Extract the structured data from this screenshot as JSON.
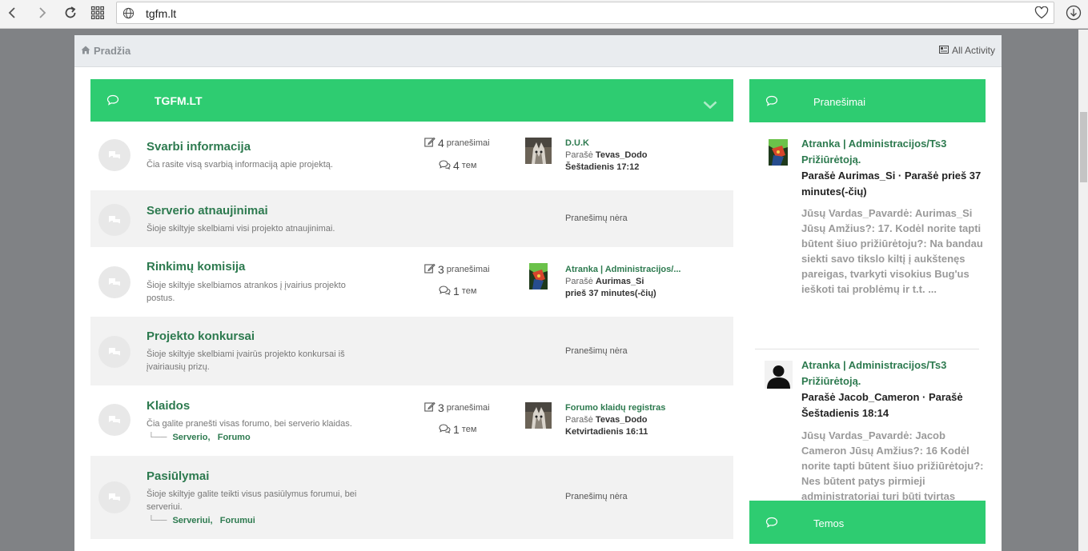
{
  "browser": {
    "url": "tgfm.lt"
  },
  "breadcrumb": {
    "home": "Pradžia",
    "all_activity": "All Activity"
  },
  "forum": {
    "title": "TGFM.LT",
    "categories": [
      {
        "name": "Svarbi informacija",
        "desc": "Čia rasite visą svarbią informaciją apie projektą.",
        "posts_count": "4",
        "posts_label": "pranešimai",
        "topics_count": "4",
        "topics_label": "тем",
        "last_title": "D.U.K",
        "last_by_prefix": "Parašė",
        "last_by": "Tevas_Dodo",
        "last_when": "Šeštadienis 17:12"
      },
      {
        "name": "Serverio atnaujinimai",
        "desc": "Šioje skiltyje skelbiami visi projekto atnaujinimai.",
        "no_posts": "Pranešimų nėra"
      },
      {
        "name": "Rinkimų komisija",
        "desc": "Šioje skiltyje skelbiamos atrankos į įvairius projekto postus.",
        "posts_count": "3",
        "posts_label": "pranešimai",
        "topics_count": "1",
        "topics_label": "тем",
        "last_title": "Atranka | Administracijos/...",
        "last_by_prefix": "Parašė",
        "last_by": "Aurimas_Si",
        "last_when": "prieš 37 minutes(-čių)"
      },
      {
        "name": "Projekto konkursai",
        "desc": "Šioje skiltyje skelbiami įvairūs projekto konkursai iš įvairiausių prizų.",
        "no_posts": "Pranešimų nėra"
      },
      {
        "name": "Klaidos",
        "desc": "Čia galite pranešti visas forumo, bei serverio klaidas.",
        "subforums": [
          "Serverio,",
          "Forumo"
        ],
        "posts_count": "3",
        "posts_label": "pranešimai",
        "topics_count": "1",
        "topics_label": "тем",
        "last_title": "Forumo klaidų registras",
        "last_by_prefix": "Parašė",
        "last_by": "Tevas_Dodo",
        "last_when": "Ketvirtadienis 16:11"
      },
      {
        "name": "Pasiūlymai",
        "desc": "Šioje skiltyje galite teikti visus pasiūlymus forumui, bei serveriui.",
        "subforums": [
          "Serveriui,",
          "Forumui"
        ],
        "no_posts": "Pranešimų nėra"
      }
    ]
  },
  "sidebar": {
    "posts_title": "Pranešimai",
    "topics_title": "Temos",
    "posts": [
      {
        "title": "Atranka | Administracijos/Ts3 Prižiūrėtoją.",
        "by": "Parašė Aurimas_Si · Parašė prieš 37 minutes(-čių)",
        "body": "Jūsų Vardas_Pavardė: Aurimas_Si Jūsų Amžius?: 17. Kodėl norite tapti būtent šiuo prižiūrėtoju?: Na bandau siekti savo tikslo kiltį į aukštenęs pareigas, tvarkyti visokius Bug'us ieškoti tai problėmų ir t.t. ..."
      },
      {
        "title": "Atranka | Administracijos/Ts3 Prižiūrėtoją.",
        "by": "Parašė Jacob_Cameron · Parašė Šeštadienis 18:14",
        "body": "Jūsų Vardas_Pavardė: Jacob Cameron Jūsų Amžius?: 16 Kodėl norite tapti būtent šiuo prižiūrėtoju?: Nes būtent patys pirmieji administratoriai turi būti tvirtas pagrindas serveriui..."
      }
    ]
  },
  "colors": {
    "accent_green": "#2ecc71",
    "link_green": "#2d7a4f"
  }
}
